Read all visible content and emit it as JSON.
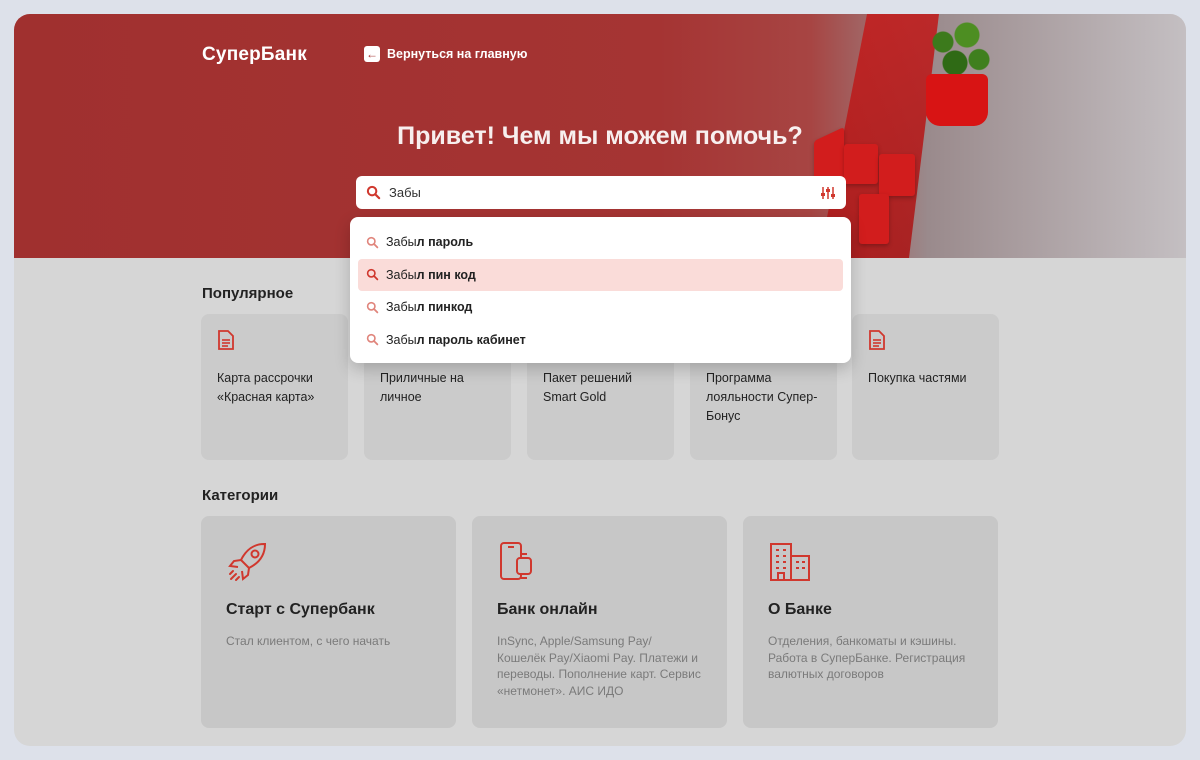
{
  "brand": "СуперБанк",
  "back_link": "Вернуться на главную",
  "hero_title": "Привет! Чем мы можем помочь?",
  "search": {
    "value": "Забы"
  },
  "suggestions": [
    {
      "prefix": "Забы",
      "rest": "л пароль"
    },
    {
      "prefix": "Забы",
      "rest": "л пин код"
    },
    {
      "prefix": "Забы",
      "rest": "л пинкод"
    },
    {
      "prefix": "Забы",
      "rest": "л пароль кабинет"
    }
  ],
  "popular": {
    "title": "Популярное",
    "items": [
      {
        "label": "Карта рассрочки «Красная карта»"
      },
      {
        "label": "Приличные на личное"
      },
      {
        "label": "Пакет решений Smart Gold"
      },
      {
        "label": "Программа лояльности Супер-Бонус"
      },
      {
        "label": "Покупка частями"
      }
    ]
  },
  "categories": {
    "title": "Категории",
    "items": [
      {
        "title": "Старт с Супербанк",
        "desc": "Стал клиентом, с чего начать",
        "icon": "rocket-icon"
      },
      {
        "title": "Банк онлайн",
        "desc": "InSync, Apple/Samsung Pay/ Кошелёк Pay/Xiaomi Pay. Платежи и переводы. Пополнение карт. Сервис «нетмонет». АИС ИДО",
        "icon": "phone-watch-icon"
      },
      {
        "title": "О Банке",
        "desc": "Отделения, банкоматы и кэшины. Работа в СуперБанке. Регистрация валютных договоров",
        "icon": "buildings-icon"
      }
    ]
  },
  "colors": {
    "accent": "#d0382e",
    "hero": "#a53433",
    "highlight": "#fadcd9"
  }
}
